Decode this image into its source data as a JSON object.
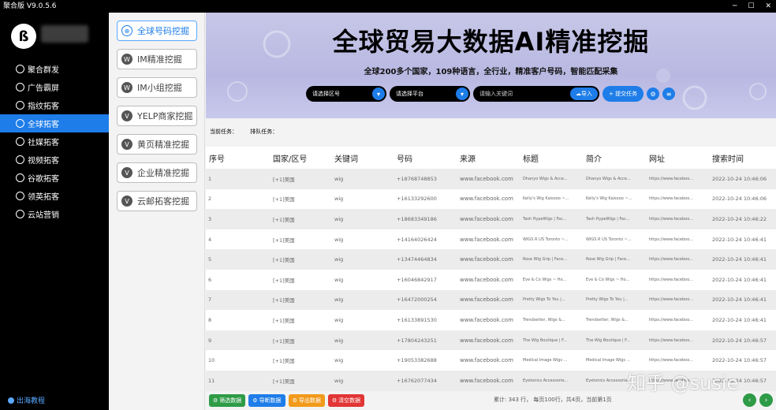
{
  "titlebar": {
    "title": "聚合版  V9.0.5.6",
    "minimize": "─",
    "maximize": "☐",
    "close": "✕"
  },
  "nav": {
    "logo_text": "ß",
    "items": [
      {
        "label": "聚合群发",
        "active": false
      },
      {
        "label": "广告霸屏",
        "active": false
      },
      {
        "label": "指纹拓客",
        "active": false
      },
      {
        "label": "全球拓客",
        "active": true
      },
      {
        "label": "社媒拓客",
        "active": false
      },
      {
        "label": "视频拓客",
        "active": false
      },
      {
        "label": "谷歌拓客",
        "active": false
      },
      {
        "label": "领英拓客",
        "active": false
      },
      {
        "label": "云站营销",
        "active": false
      }
    ],
    "bottom_label": "出海教程"
  },
  "submenu": {
    "items": [
      {
        "label": "全球号码挖掘",
        "icon": "globe-icon",
        "active": true
      },
      {
        "label": "IM精准挖掘",
        "icon": "w-icon",
        "active": false
      },
      {
        "label": "IM小组挖掘",
        "icon": "w-icon",
        "active": false
      },
      {
        "label": "YELP商家挖掘",
        "icon": "v-icon",
        "active": false
      },
      {
        "label": "黄页精准挖掘",
        "icon": "v-icon",
        "active": false
      },
      {
        "label": "企业精准挖掘",
        "icon": "v-icon",
        "active": false
      },
      {
        "label": "云邮拓客挖掘",
        "icon": "v-icon",
        "active": false
      }
    ]
  },
  "banner": {
    "title": "全球贸易大数据AI精准挖掘",
    "subtitle": "全球200多个国家，109种语言，全行业，精准客户号码，智能匹配采集",
    "country_placeholder": "请选择区号",
    "platform_placeholder": "请选择平台",
    "keyword_placeholder": "请输入关键词",
    "import_label": "导入",
    "submit_label": "+ 提交任务"
  },
  "status": {
    "current_task": "当前任务：",
    "queue_task": "排队任务："
  },
  "table": {
    "headers": [
      "序号",
      "国家/区号",
      "关键词",
      "号码",
      "来源",
      "标题",
      "简介",
      "网址",
      "搜索时间"
    ],
    "rows": [
      [
        "1",
        "[+1]美国",
        "wig",
        "+18768748853",
        "www.facebook.com",
        "Dhanyo Wigs & Acce...",
        "Dhanyo Wigs & Acce...",
        "https://www.faceboo...",
        "2022-10-24 10:46:06"
      ],
      [
        "2",
        "[+1]美国",
        "wig",
        "+16133292600",
        "www.facebook.com",
        "Kelly's Wig Kaisooo ~...",
        "Kelly's Wig Kaisooo ~...",
        "https://www.faceboo...",
        "2022-10-24 10:46:06"
      ],
      [
        "3",
        "[+1]美国",
        "wig",
        "+18683349186",
        "www.facebook.com",
        "Tash HypeWigs | Fac...",
        "Tash HypeWigs | Fac...",
        "https://www.faceboo...",
        "2022-10-24 10:46:22"
      ],
      [
        "4",
        "[+1]美国",
        "wig",
        "+14164026424",
        "www.facebook.com",
        "WIGS R US Toronto ~...",
        "WIGS R US Toronto ~...",
        "https://www.faceboo...",
        "2022-10-24 10:46:41"
      ],
      [
        "5",
        "[+1]美国",
        "wig",
        "+13474464834",
        "www.facebook.com",
        "Rose Wig Grip | Face...",
        "Rose Wig Grip | Face...",
        "https://www.faceboo...",
        "2022-10-24 10:46:41"
      ],
      [
        "6",
        "[+1]美国",
        "wig",
        "+16046842917",
        "www.facebook.com",
        "Eve & Co Wigs ~ Ho...",
        "Eve & Co Wigs ~ Ho...",
        "https://www.faceboo...",
        "2022-10-24 10:46:41"
      ],
      [
        "7",
        "[+1]美国",
        "wig",
        "+16472000254",
        "www.facebook.com",
        "Pretty Wigs To You |...",
        "Pretty Wigs To You |...",
        "https://www.faceboo...",
        "2022-10-24 10:46:41"
      ],
      [
        "8",
        "[+1]美国",
        "wig",
        "+16133891530",
        "www.facebook.com",
        "Trendsetter, Wigs &...",
        "Trendsetter, Wigs &...",
        "https://www.faceboo...",
        "2022-10-24 10:46:41"
      ],
      [
        "9",
        "[+1]美国",
        "wig",
        "+17804243251",
        "www.facebook.com",
        "The Wig Boutique | F...",
        "The Wig Boutique | F...",
        "https://www.faceboo...",
        "2022-10-24 10:46:57"
      ],
      [
        "10",
        "[+1]美国",
        "wig",
        "+19053382688",
        "www.facebook.com",
        "Medical Image Wigs ...",
        "Medical Image Wigs ...",
        "https://www.faceboo...",
        "2022-10-24 10:46:57"
      ],
      [
        "11",
        "[+1]美国",
        "wig",
        "+16762077434",
        "www.facebook.com",
        "Eyetonics Accessorie...",
        "Eyetonics Accessorie...",
        "https://www.faceboo...",
        "2022-10-24 10:46:57"
      ]
    ]
  },
  "bottom": {
    "filter_label": "筛选数据",
    "import_label": "导断数据",
    "export_label": "导出数据",
    "clear_label": "清空数据",
    "pager_text": "累计: 343 行，  每页100行，共4页，当前第1页",
    "prev": "‹",
    "next": "›"
  },
  "watermark": "知乎 @susie",
  "colors": {
    "accent": "#1e7de8",
    "nav_bg": "#000000",
    "green": "#2e9b47",
    "orange": "#f29a1b",
    "red": "#e23535"
  }
}
